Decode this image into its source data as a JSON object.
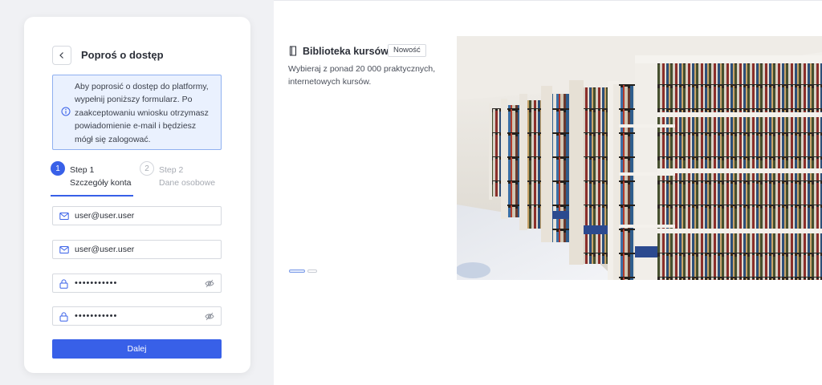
{
  "form": {
    "title": "Poproś o dostęp",
    "info": "Aby poprosić o dostęp do platformy, wypełnij poniższy formularz. Po zaakceptowaniu wniosku otrzymasz powiadomienie e-mail i będziesz mógł się zalogować.",
    "steps": [
      {
        "number": "1",
        "label": "Step 1",
        "sub": "Szczegóły konta",
        "active": true
      },
      {
        "number": "2",
        "label": "Step 2",
        "sub": "Dane osobowe",
        "active": false
      }
    ],
    "fields": [
      {
        "icon": "mail-icon",
        "value": "user@user.user"
      },
      {
        "icon": "mail-icon",
        "value": "user@user.user"
      },
      {
        "icon": "lock-icon",
        "value": "•••••••••••"
      },
      {
        "icon": "lock-icon",
        "value": "•••••••••••"
      }
    ],
    "next_label": "Dalej"
  },
  "showcase": {
    "title": "Biblioteka kursów",
    "badge": "Nowość",
    "description": "Wybieraj z ponad 20 000 praktycznych, internetowych kursów.",
    "slides": [
      {
        "active": true
      },
      {
        "active": false
      }
    ]
  },
  "colors": {
    "accent": "#3860e8",
    "info_bg": "#eaf1fe",
    "info_border": "#8fb0f0",
    "left_bg": "#f0f1f4"
  }
}
